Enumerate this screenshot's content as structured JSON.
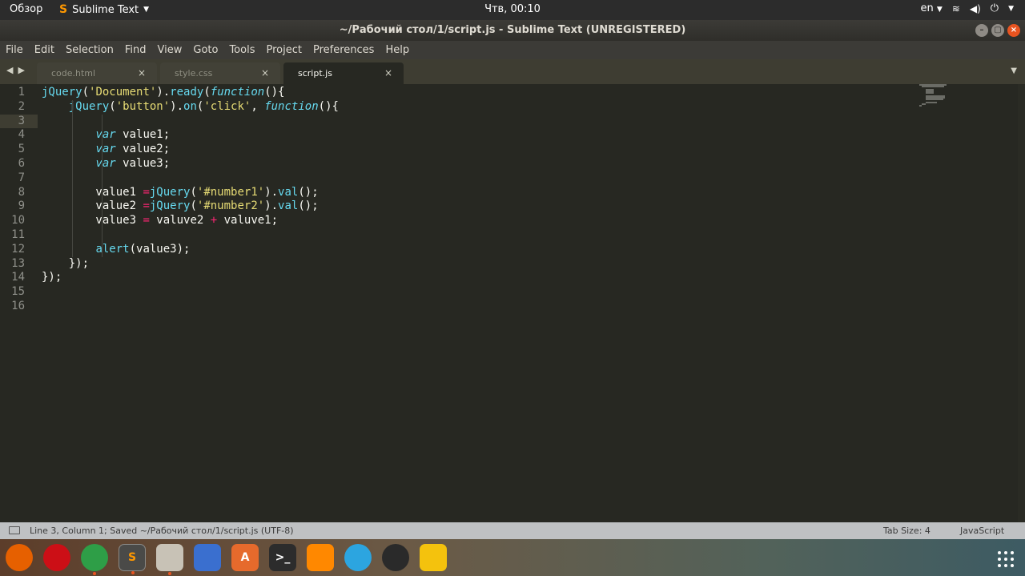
{
  "top_panel": {
    "activities": "Обзор",
    "app_name": "Sublime Text",
    "clock": "Чтв, 00:10",
    "language": "en"
  },
  "window": {
    "title": "~/Рабочий стол/1/script.js - Sublime Text (UNREGISTERED)"
  },
  "menu": [
    "File",
    "Edit",
    "Selection",
    "Find",
    "View",
    "Goto",
    "Tools",
    "Project",
    "Preferences",
    "Help"
  ],
  "tabs": [
    {
      "label": "code.html",
      "active": false
    },
    {
      "label": "style.css",
      "active": false
    },
    {
      "label": "script.js",
      "active": true
    }
  ],
  "editor": {
    "current_line": 3,
    "line_numbers": [
      "1",
      "2",
      "3",
      "4",
      "5",
      "6",
      "7",
      "8",
      "9",
      "10",
      "11",
      "12",
      "13",
      "14",
      "15",
      "16"
    ],
    "lines": [
      [
        {
          "t": "jQuery",
          "c": "fn"
        },
        {
          "t": "(",
          "c": "p"
        },
        {
          "t": "'Document'",
          "c": "str"
        },
        {
          "t": ").",
          "c": "p"
        },
        {
          "t": "ready",
          "c": "fn"
        },
        {
          "t": "(",
          "c": "p"
        },
        {
          "t": "function",
          "c": "kw"
        },
        {
          "t": "(){",
          "c": "p"
        }
      ],
      [
        {
          "t": "    ",
          "c": "p"
        },
        {
          "t": "jQuery",
          "c": "fn"
        },
        {
          "t": "(",
          "c": "p"
        },
        {
          "t": "'button'",
          "c": "str"
        },
        {
          "t": ").",
          "c": "p"
        },
        {
          "t": "on",
          "c": "fn"
        },
        {
          "t": "(",
          "c": "p"
        },
        {
          "t": "'click'",
          "c": "str"
        },
        {
          "t": ", ",
          "c": "p"
        },
        {
          "t": "function",
          "c": "kw"
        },
        {
          "t": "(){",
          "c": "p"
        }
      ],
      [],
      [
        {
          "t": "        ",
          "c": "p"
        },
        {
          "t": "var",
          "c": "kw"
        },
        {
          "t": " value1;",
          "c": "p"
        }
      ],
      [
        {
          "t": "        ",
          "c": "p"
        },
        {
          "t": "var",
          "c": "kw"
        },
        {
          "t": " value2;",
          "c": "p"
        }
      ],
      [
        {
          "t": "        ",
          "c": "p"
        },
        {
          "t": "var",
          "c": "kw"
        },
        {
          "t": " value3;",
          "c": "p"
        }
      ],
      [],
      [
        {
          "t": "        value1 ",
          "c": "p"
        },
        {
          "t": "=",
          "c": "op"
        },
        {
          "t": "jQuery",
          "c": "fn"
        },
        {
          "t": "(",
          "c": "p"
        },
        {
          "t": "'#number1'",
          "c": "str"
        },
        {
          "t": ").",
          "c": "p"
        },
        {
          "t": "val",
          "c": "fn"
        },
        {
          "t": "();",
          "c": "p"
        }
      ],
      [
        {
          "t": "        value2 ",
          "c": "p"
        },
        {
          "t": "=",
          "c": "op"
        },
        {
          "t": "jQuery",
          "c": "fn"
        },
        {
          "t": "(",
          "c": "p"
        },
        {
          "t": "'#number2'",
          "c": "str"
        },
        {
          "t": ").",
          "c": "p"
        },
        {
          "t": "val",
          "c": "fn"
        },
        {
          "t": "();",
          "c": "p"
        }
      ],
      [
        {
          "t": "        value3 ",
          "c": "p"
        },
        {
          "t": "=",
          "c": "op"
        },
        {
          "t": " valuve2 ",
          "c": "p"
        },
        {
          "t": "+",
          "c": "op"
        },
        {
          "t": " valuve1;",
          "c": "p"
        }
      ],
      [],
      [
        {
          "t": "        ",
          "c": "p"
        },
        {
          "t": "alert",
          "c": "fn"
        },
        {
          "t": "(value3);",
          "c": "p"
        }
      ],
      [
        {
          "t": "    });",
          "c": "p"
        }
      ],
      [
        {
          "t": "});",
          "c": "p"
        }
      ],
      [],
      []
    ]
  },
  "status_bar": {
    "message": "Line 3, Column 1; Saved ~/Рабочий стол/1/script.js (UTF-8)",
    "tab_size": "Tab Size: 4",
    "syntax": "JavaScript"
  },
  "dock": {
    "apps": [
      {
        "name": "firefox-icon",
        "glyph": "",
        "color": "#e66000",
        "running": false
      },
      {
        "name": "opera-icon",
        "glyph": "",
        "color": "#cc0f16",
        "running": false
      },
      {
        "name": "chrome-icon",
        "glyph": "",
        "color": "#2e9e47",
        "running": true
      },
      {
        "name": "sublime-text-icon",
        "glyph": "S",
        "color": "#4a4a48",
        "running": true
      },
      {
        "name": "archive-manager-icon",
        "glyph": "",
        "color": "#c8c2b6",
        "running": true
      },
      {
        "name": "document-viewer-icon",
        "glyph": "",
        "color": "#3a6fcf",
        "running": false
      },
      {
        "name": "software-center-icon",
        "glyph": "A",
        "color": "#e66a2c",
        "running": false
      },
      {
        "name": "terminal-icon",
        "glyph": ">_",
        "color": "#2c2c2c",
        "running": false
      },
      {
        "name": "vlc-icon",
        "glyph": "",
        "color": "#ff8800",
        "running": false
      },
      {
        "name": "telegram-icon",
        "glyph": "",
        "color": "#2ca5e0",
        "running": false
      },
      {
        "name": "davinci-resolve-icon",
        "glyph": "",
        "color": "#2a2a2a",
        "running": false
      },
      {
        "name": "lightbulb-app-icon",
        "glyph": "",
        "color": "#f4c20d",
        "running": false
      }
    ]
  },
  "colors": {
    "editor_bg": "#272822",
    "function": "#66d9ef",
    "string": "#e6db74",
    "operator": "#f92672",
    "text": "#f8f8f2",
    "accent": "#e95420"
  }
}
